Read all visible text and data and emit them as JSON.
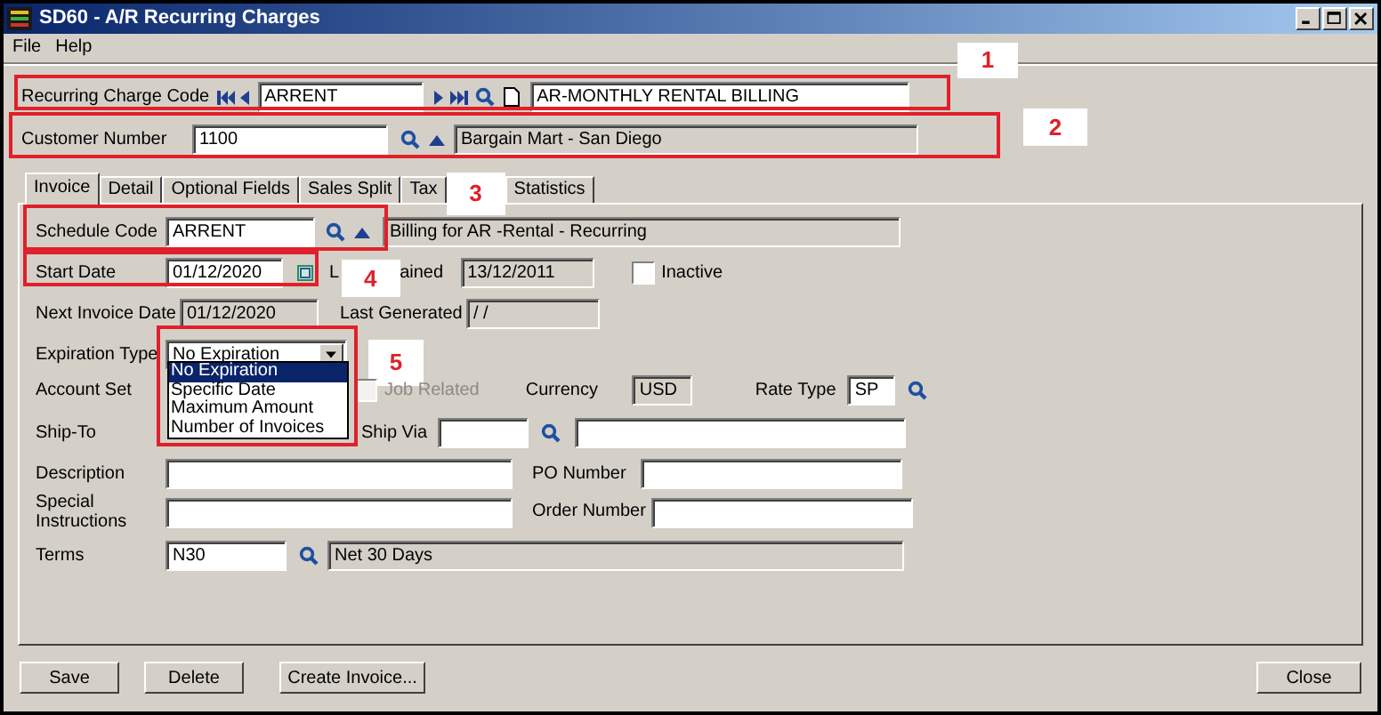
{
  "window": {
    "title": "SD60 - A/R Recurring Charges"
  },
  "menu": [
    "File",
    "Help"
  ],
  "header": {
    "recurring_charge_code": {
      "label": "Recurring Charge Code",
      "value": "ARRENT",
      "description": "AR-MONTHLY RENTAL BILLING"
    },
    "customer_number": {
      "label": "Customer Number",
      "value": "1100",
      "description": "Bargain Mart - San Diego"
    }
  },
  "tabs": [
    {
      "label": "Invoice",
      "selected": true
    },
    {
      "label": "Detail",
      "selected": false
    },
    {
      "label": "Optional Fields",
      "selected": false
    },
    {
      "label": "Sales Split",
      "selected": false
    },
    {
      "label": "Tax",
      "selected": false
    },
    {
      "label": "Statistics",
      "selected": false
    }
  ],
  "invoice": {
    "schedule_code": {
      "label": "Schedule Code",
      "value": "ARRENT",
      "description": "Billing for AR -Rental - Recurring"
    },
    "start_date": {
      "label": "Start Date",
      "value": "01/12/2020"
    },
    "last_maintained": {
      "label_parts": [
        "L",
        "ained"
      ],
      "value": "13/12/2011"
    },
    "inactive": {
      "label": "Inactive",
      "checked": false
    },
    "next_invoice_date": {
      "label": "Next Invoice Date",
      "value": "01/12/2020"
    },
    "last_generated": {
      "label": "Last Generated",
      "value": "/ /"
    },
    "expiration_type": {
      "label": "Expiration Type",
      "value": "No Expiration",
      "expanded": true,
      "options": [
        {
          "label": "No Expiration",
          "selected": true
        },
        {
          "label": "Specific Date",
          "selected": false
        },
        {
          "label": "Maximum Amount",
          "selected": false
        },
        {
          "label": "Number of Invoices",
          "selected": false
        }
      ]
    },
    "account_set": {
      "label": "Account Set"
    },
    "job_related": {
      "label": "Job Related",
      "checked": false,
      "disabled": true
    },
    "currency": {
      "label": "Currency",
      "value": "USD"
    },
    "rate_type": {
      "label": "Rate Type",
      "value": "SP"
    },
    "ship_to": {
      "label": "Ship-To"
    },
    "ship_via": {
      "label": "Ship Via"
    },
    "description": {
      "label": "Description"
    },
    "po_number": {
      "label": "PO Number"
    },
    "special_instructions": {
      "label": "Special Instructions"
    },
    "order_number": {
      "label": "Order Number"
    },
    "terms": {
      "label": "Terms",
      "value": "N30",
      "description": "Net 30 Days"
    }
  },
  "buttons": [
    "Save",
    "Delete",
    "Create Invoice..."
  ],
  "close_button": "Close",
  "callouts": [
    "1",
    "2",
    "3",
    "4",
    "5"
  ]
}
